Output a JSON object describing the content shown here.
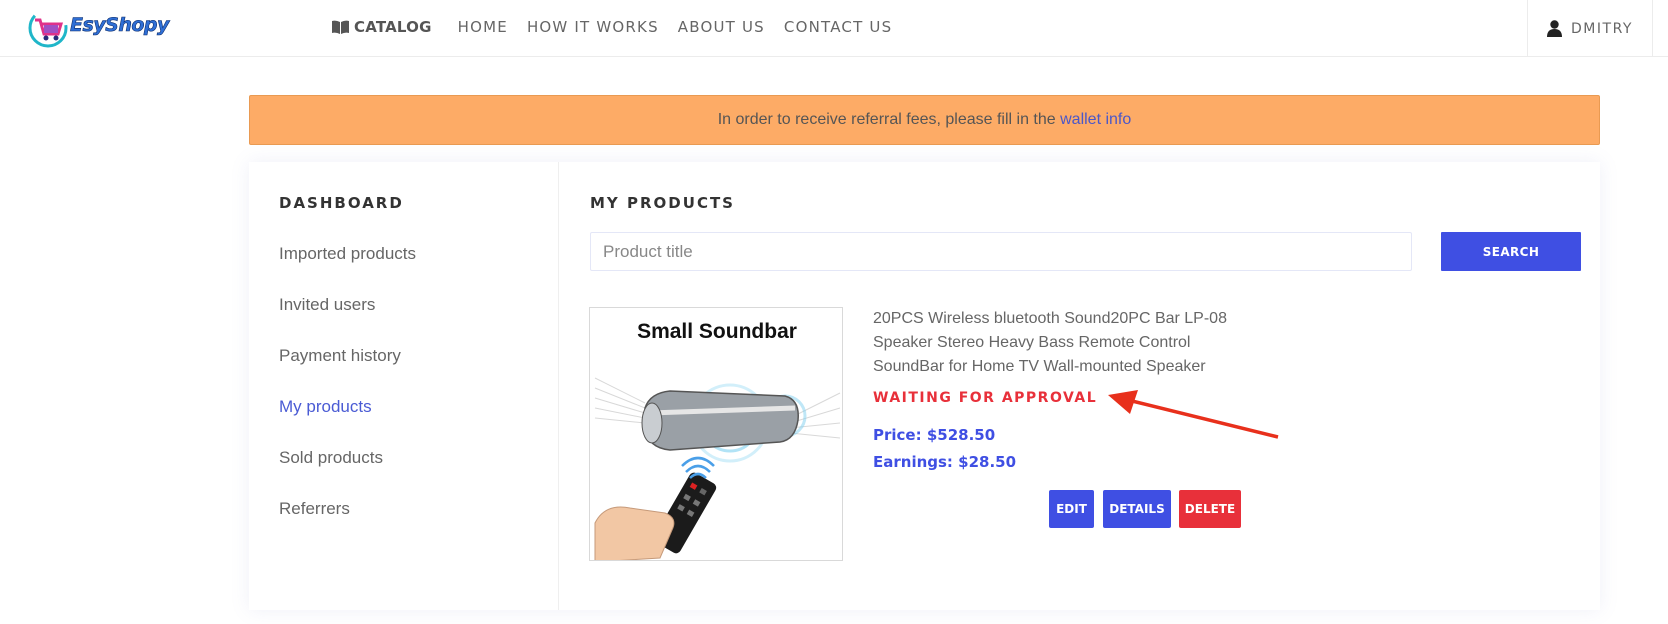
{
  "header": {
    "logo_text": "EsyShopy",
    "nav": [
      {
        "label": "CATALOG"
      },
      {
        "label": "HOME"
      },
      {
        "label": "HOW IT WORKS"
      },
      {
        "label": "ABOUT US"
      },
      {
        "label": "CONTACT US"
      }
    ],
    "user": "DMITRY"
  },
  "alert": {
    "text": "In order to receive referral fees, please fill in the ",
    "link": "wallet info"
  },
  "sidebar": {
    "title": "DASHBOARD",
    "items": [
      {
        "label": "Imported products"
      },
      {
        "label": "Invited users"
      },
      {
        "label": "Payment history"
      },
      {
        "label": "My products",
        "active": true
      },
      {
        "label": "Sold products"
      },
      {
        "label": "Referrers"
      }
    ]
  },
  "main": {
    "title": "MY PRODUCTS",
    "search": {
      "placeholder": "Product title",
      "value": "",
      "button": "SEARCH"
    },
    "product": {
      "image_caption": "Small Soundbar",
      "title": "20PCS Wireless bluetooth Sound20PC Bar LP-08 Speaker Stereo Heavy Bass Remote Control SoundBar for Home TV Wall-mounted Speaker",
      "status": "WAITING FOR APPROVAL",
      "price": "Price: $528.50",
      "earnings": "Earnings: $28.50",
      "actions": {
        "edit": "EDIT",
        "details": "DETAILS",
        "delete": "DELETE"
      }
    }
  },
  "colors": {
    "accent": "#3f4fe3",
    "danger": "#e8303a",
    "alert_bg": "#fdab66",
    "annotation_arrow": "#e8301c"
  },
  "icons": [
    "cart-logo-icon",
    "book-icon",
    "user-icon",
    "annotation-arrow-icon"
  ]
}
